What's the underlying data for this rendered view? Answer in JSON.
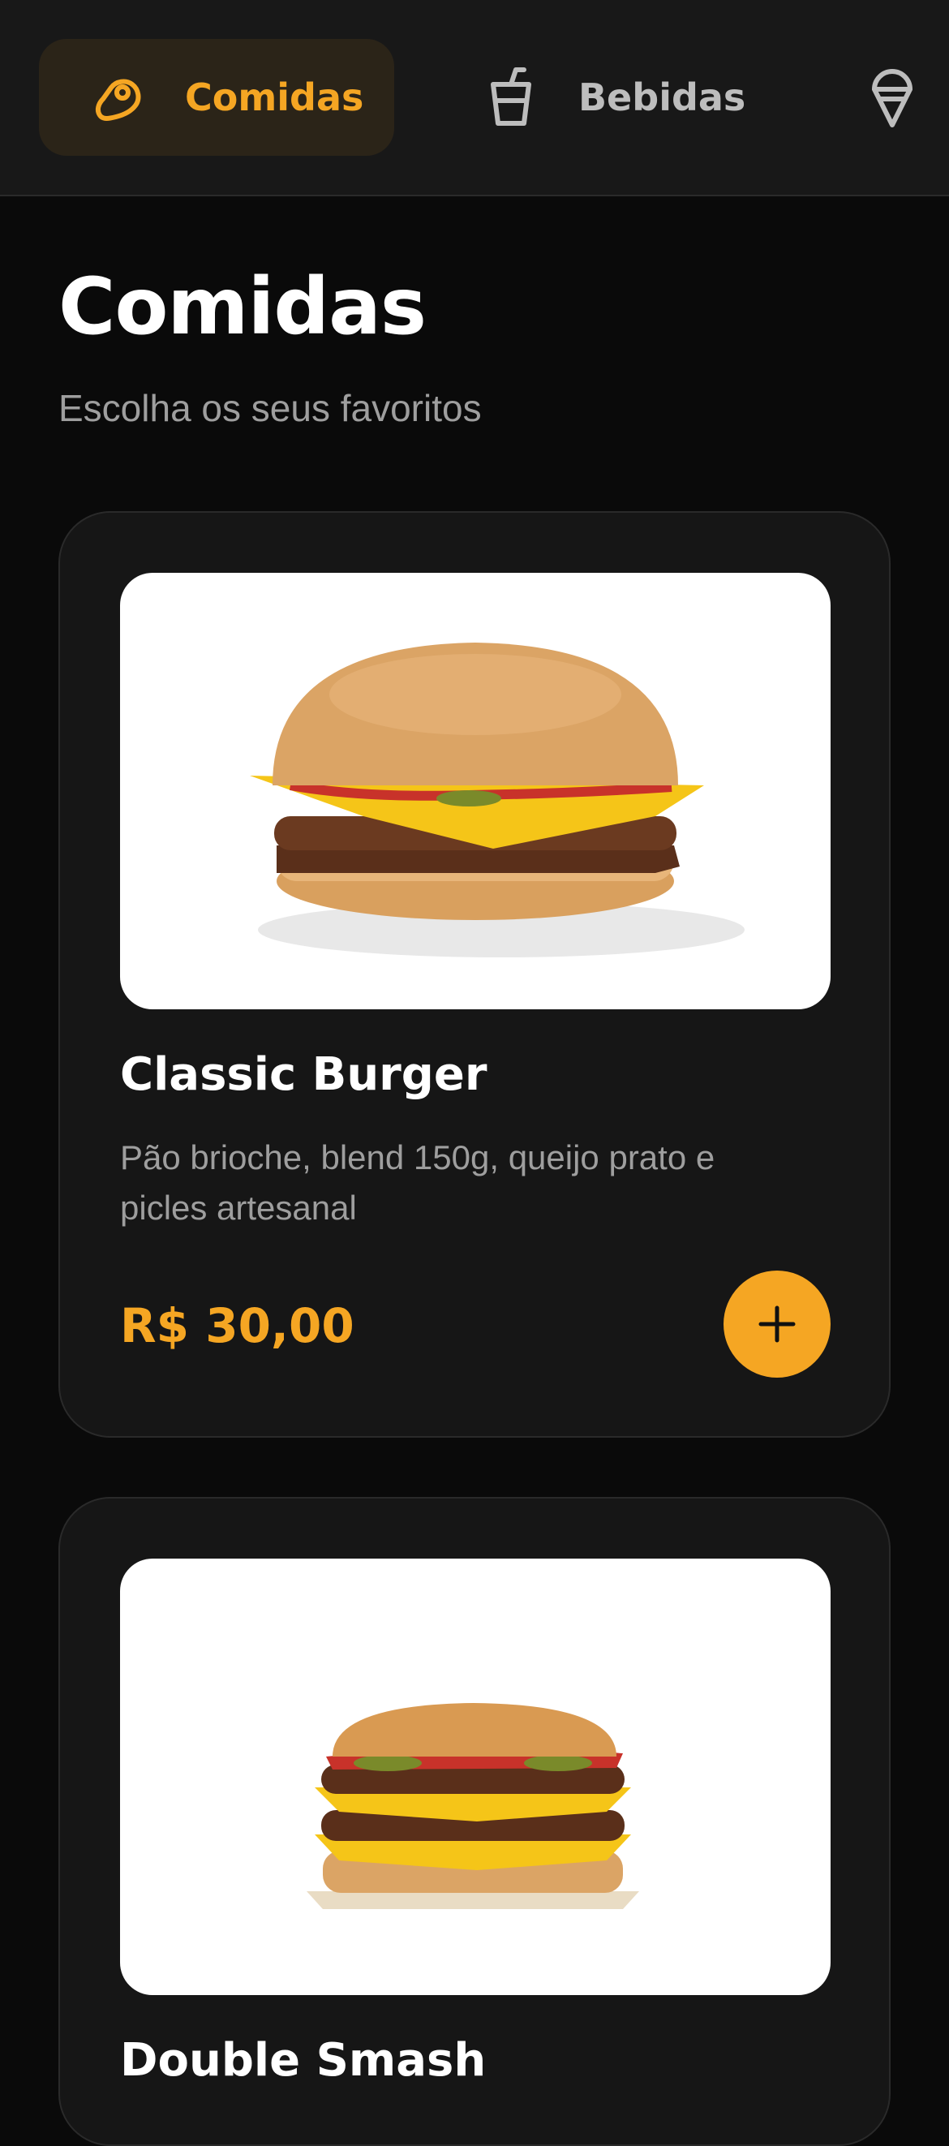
{
  "nav": {
    "tabs": [
      {
        "label": "Comidas",
        "icon": "meat-icon",
        "active": true
      },
      {
        "label": "Bebidas",
        "icon": "cup-icon",
        "active": false
      },
      {
        "label": "",
        "icon": "ice-cream-icon",
        "active": false
      }
    ]
  },
  "page": {
    "title": "Comidas",
    "subtitle": "Escolha os seus favoritos"
  },
  "items": [
    {
      "name": "Classic Burger",
      "description": "Pão brioche, blend 150g, queijo prato e picles artesanal",
      "price": "R$ 30,00",
      "image": "classic-burger-photo",
      "add_icon": "plus-icon"
    },
    {
      "name": "Double Smash",
      "image": "double-burger-photo"
    }
  ],
  "colors": {
    "accent": "#f5a623",
    "background": "#0a0a0a",
    "card": "#161616",
    "nav": "#181818",
    "muted_text": "#9e9e9e"
  }
}
